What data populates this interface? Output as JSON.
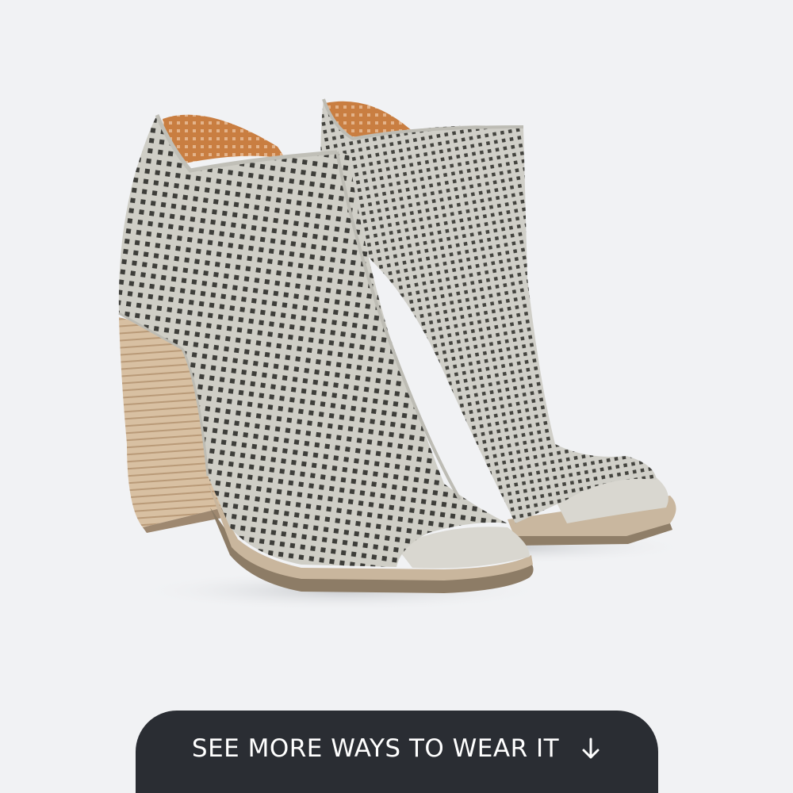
{
  "cta": {
    "label": "SEE MORE WAYS TO WEAR IT",
    "icon": "arrow-down-icon"
  },
  "product": {
    "image": "perforated-peep-toe-ankle-booties-photo"
  },
  "colors": {
    "background": "#f1f2f4",
    "button": "#2a2d33",
    "button_text": "#ffffff",
    "suede": "#cfcec6",
    "heel_wood": "#d2b89a",
    "lining": "#c97e41"
  }
}
